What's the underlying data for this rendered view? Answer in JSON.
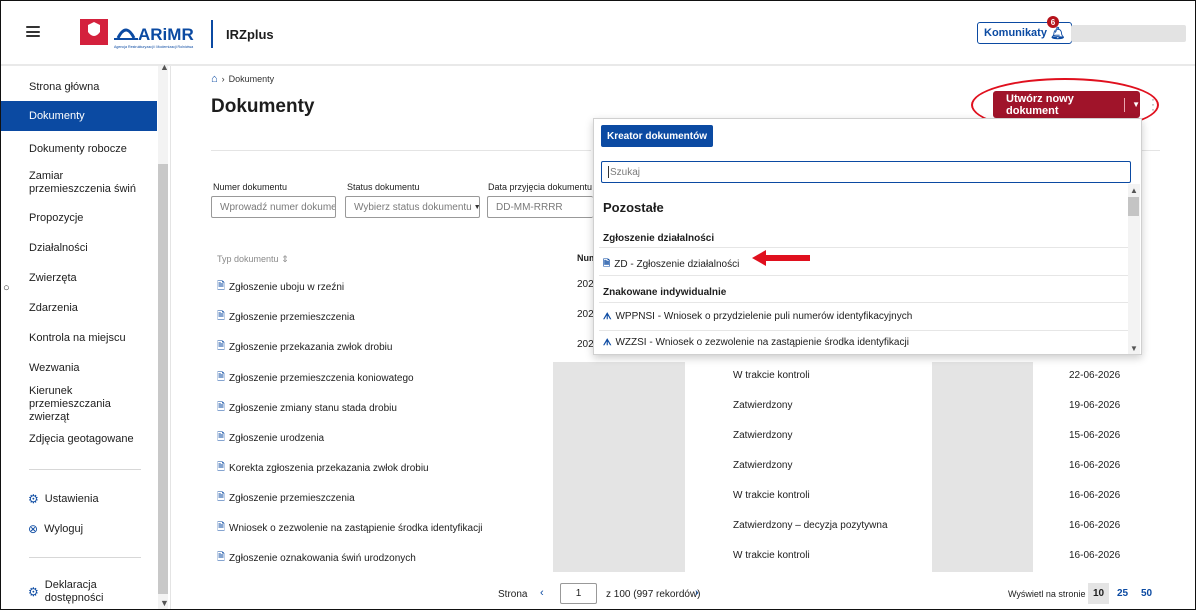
{
  "header": {
    "logo_text": "ARiMR",
    "logo_subtext": "Agencja Restrukturyzacji i Modernizacji Rolnictwa",
    "app_name": "IRZplus",
    "messages_label": "Komunikaty",
    "messages_count": "6"
  },
  "sidebar": {
    "items": [
      {
        "label": "Strona główna"
      },
      {
        "label": "Dokumenty"
      },
      {
        "label": "Dokumenty robocze"
      },
      {
        "label": "Zamiar przemieszczenia świń"
      },
      {
        "label": "Propozycje"
      },
      {
        "label": "Działalności"
      },
      {
        "label": "Zwierzęta"
      },
      {
        "label": "Zdarzenia"
      },
      {
        "label": "Kontrola na miejscu"
      },
      {
        "label": "Wezwania"
      },
      {
        "label": "Kierunek przemieszczania zwierząt"
      },
      {
        "label": "Zdjęcia geotagowane"
      }
    ],
    "settings": "Ustawienia",
    "logout": "Wyloguj",
    "accessibility": "Deklaracja dostępności",
    "active_color": "#0b4aa2"
  },
  "breadcrumb": {
    "current": "Dokumenty"
  },
  "page": {
    "title": "Dokumenty",
    "create_button": "Utwórz nowy dokument",
    "accent_color": "#a0142a"
  },
  "filters": {
    "doc_number_label": "Numer dokumentu",
    "doc_number_placeholder": "Wprowadź numer dokumentu",
    "status_label": "Status dokumentu",
    "status_placeholder": "Wybierz status dokumentu",
    "date_label": "Data przyjęcia dokumentu od",
    "date_placeholder": "DD-MM-RRRR"
  },
  "table": {
    "col_type": "Typ dokumentu",
    "col_number": "Num",
    "rows": [
      {
        "type": "Zgłoszenie uboju w rzeźni",
        "number": "202",
        "status": "",
        "date": ""
      },
      {
        "type": "Zgłoszenie przemieszczenia",
        "number": "202",
        "status": "",
        "date": ""
      },
      {
        "type": "Zgłoszenie przekazania zwłok drobiu",
        "number": "202",
        "status": "",
        "date": ""
      },
      {
        "type": "Zgłoszenie przemieszczenia koniowatego",
        "number": "",
        "status": "W trakcie kontroli",
        "date": "22-06-2026"
      },
      {
        "type": "Zgłoszenie zmiany stanu stada drobiu",
        "number": "",
        "status": "Zatwierdzony",
        "date": "19-06-2026"
      },
      {
        "type": "Zgłoszenie urodzenia",
        "number": "",
        "status": "Zatwierdzony",
        "date": "15-06-2026"
      },
      {
        "type": "Korekta zgłoszenia przekazania zwłok drobiu",
        "number": "",
        "status": "Zatwierdzony",
        "date": "16-06-2026"
      },
      {
        "type": "Zgłoszenie przemieszczenia",
        "number": "",
        "status": "W trakcie kontroli",
        "date": "16-06-2026"
      },
      {
        "type": "Wniosek o zezwolenie na zastąpienie środka identyfikacji",
        "number": "",
        "status": "Zatwierdzony – decyzja pozytywna",
        "date": "16-06-2026"
      },
      {
        "type": "Zgłoszenie oznakowania świń urodzonych",
        "number": "",
        "status": "W trakcie kontroli",
        "date": "16-06-2026"
      }
    ]
  },
  "pagination": {
    "label": "Strona",
    "current_page": "1",
    "of_text": "z 100 (997 rekordów)",
    "per_page_label": "Wyświetl na stronie",
    "per_page_options": [
      "10",
      "25",
      "50"
    ]
  },
  "dropdown": {
    "creator_button": "Kreator dokumentów",
    "search_placeholder": "Szukaj",
    "section": "Pozostałe",
    "groups": [
      {
        "title": "Zgłoszenie działalności",
        "items": [
          {
            "icon": "document-icon",
            "label": "ZD - Zgłoszenie działalności"
          }
        ]
      },
      {
        "title": "Znakowane indywidualnie",
        "items": [
          {
            "icon": "ear-tag-icon",
            "label": "WPPNSI - Wniosek o przydzielenie puli numerów identyfikacyjnych"
          },
          {
            "icon": "ear-tag-icon",
            "label": "WZZSI - Wniosek o zezwolenie na zastąpienie środka identyfikacji"
          }
        ]
      }
    ]
  },
  "annotations": {
    "highlight_color": "#e0101e"
  }
}
